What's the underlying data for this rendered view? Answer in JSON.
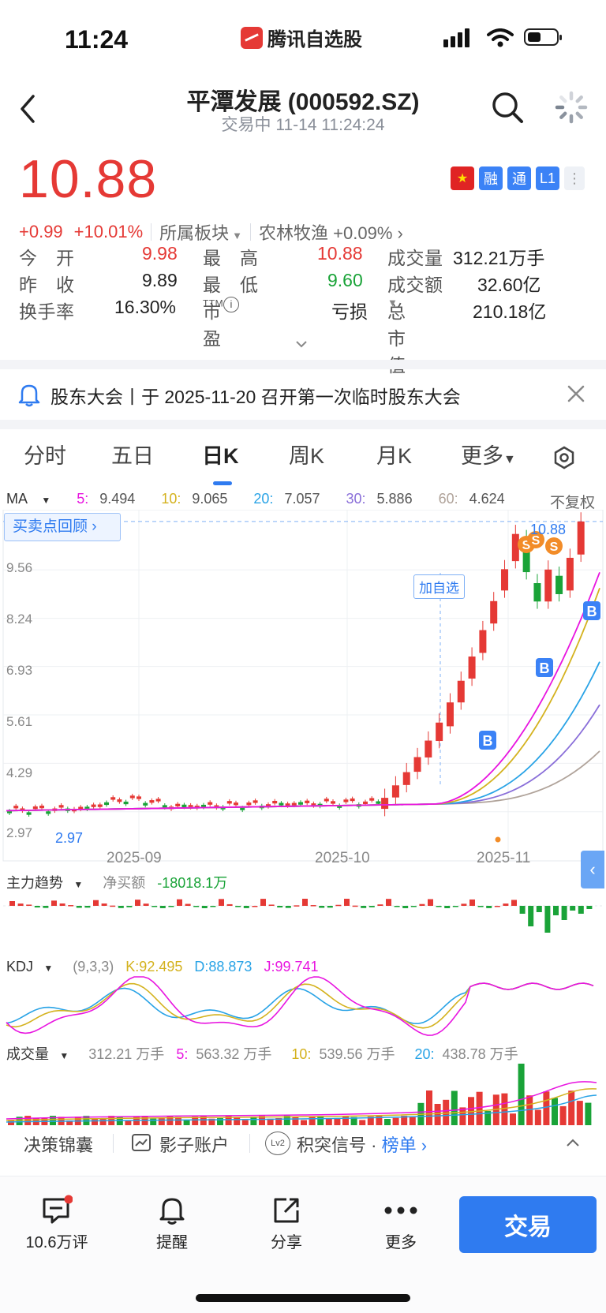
{
  "status_bar": {
    "time": "11:24",
    "app_name": "腾讯自选股"
  },
  "header": {
    "title": "平潭发展 (000592.SZ)",
    "trade_status": "交易中   11-14 11:24:24"
  },
  "quote": {
    "price": "10.88",
    "change": "+0.99",
    "change_pct": "+10.01%",
    "sector_label": "所属板块",
    "industry": "农林牧渔",
    "industry_change": "+0.09%",
    "badges": [
      "融",
      "通",
      "L1"
    ]
  },
  "stats": {
    "open_label": "今　开",
    "open": "9.98",
    "high_label": "最　高",
    "high": "10.88",
    "volume_label": "成交量",
    "volume": "312.21万手",
    "prev_close_label": "昨　收",
    "prev_close": "9.89",
    "low_label": "最　低",
    "low": "9.60",
    "amount_label": "成交额",
    "amount": "32.60亿",
    "turnover_label": "换手率",
    "turnover": "16.30%",
    "pe_label": "市盈",
    "pe_sup": "TTM",
    "pe": "亏损",
    "market_cap_label": "总市值",
    "market_cap": "210.18亿"
  },
  "notice": {
    "text": "股东大会丨于 2025-11-20 召开第一次临时股东大会"
  },
  "tabs": [
    "分时",
    "五日",
    "日K",
    "周K",
    "月K",
    "更多"
  ],
  "active_tab": 2,
  "ma": {
    "label": "MA",
    "ma5": "9.494",
    "ma10": "9.065",
    "ma20": "7.057",
    "ma30": "5.886",
    "ma60": "4.624",
    "adjust": "不复权",
    "k5": "5:",
    "k10": "10:",
    "k20": "20:",
    "k30": "30:",
    "k60": "60:"
  },
  "review_button": "买卖点回顾",
  "add_watch": "加自选",
  "chart_labels": {
    "y_ticks": [
      "9.56",
      "8.24",
      "6.93",
      "5.61",
      "4.29",
      "2.97"
    ],
    "x_ticks": [
      "2025-09",
      "2025-10",
      "2025-11"
    ],
    "max_price": "10.88",
    "min_price": "2.97"
  },
  "main_force": {
    "label": "主力趋势",
    "net_label": "净买额",
    "net_value": "-18018.1万"
  },
  "kdj": {
    "label": "KDJ",
    "params": "(9,3,3)",
    "k": "K:92.495",
    "d": "D:88.873",
    "j": "J:99.741"
  },
  "volume_ind": {
    "label": "成交量",
    "current": "312.21 万手",
    "v5": "563.32 万手",
    "v10": "539.56 万手",
    "v20": "438.78 万手",
    "k5": "5:",
    "k10": "10:",
    "k20": "20:"
  },
  "tools": {
    "decision": "决策锦囊",
    "shadow": "影子账户",
    "signal": "积突信号",
    "ranking": "榜单",
    "level": "Lv2"
  },
  "bottom_nav": {
    "comments": "10.6万评",
    "remind": "提醒",
    "share": "分享",
    "more": "更多",
    "trade": "交易"
  },
  "colors": {
    "up": "#e53935",
    "down": "#1aa338",
    "accent": "#2f7bf0",
    "ma5": "#e815e0",
    "ma10": "#d4b21e",
    "ma20": "#29a3e6",
    "ma30": "#8a6fd9",
    "ma60": "#b0a39a"
  },
  "chart_data": {
    "type": "candlestick",
    "x_ticks": [
      "2025-09",
      "2025-10",
      "2025-11"
    ],
    "y_ticks": [
      9.56,
      8.24,
      6.93,
      5.61,
      4.29,
      2.97
    ],
    "ylim": [
      2.6,
      11.2
    ],
    "close_last": 10.88,
    "ma_last": {
      "MA5": 9.494,
      "MA10": 9.065,
      "MA20": 7.057,
      "MA30": 5.886,
      "MA60": 4.624
    },
    "candles_recent": [
      {
        "o": 3.05,
        "c": 3.35
      },
      {
        "o": 3.36,
        "c": 3.69
      },
      {
        "o": 3.7,
        "c": 4.05
      },
      {
        "o": 4.06,
        "c": 4.46
      },
      {
        "o": 4.45,
        "c": 4.91
      },
      {
        "o": 4.9,
        "c": 5.4
      },
      {
        "o": 5.3,
        "c": 5.95
      },
      {
        "o": 5.95,
        "c": 6.54
      },
      {
        "o": 6.6,
        "c": 7.2
      },
      {
        "o": 7.3,
        "c": 7.92
      },
      {
        "o": 8.1,
        "c": 8.71
      },
      {
        "o": 9.0,
        "c": 9.58
      },
      {
        "o": 9.8,
        "c": 10.54
      },
      {
        "o": 10.4,
        "c": 9.5
      },
      {
        "o": 9.2,
        "c": 8.7
      },
      {
        "o": 8.7,
        "c": 9.57
      },
      {
        "o": 9.4,
        "c": 8.9
      },
      {
        "o": 9.0,
        "c": 9.89
      },
      {
        "o": 9.98,
        "c": 10.88
      }
    ]
  }
}
